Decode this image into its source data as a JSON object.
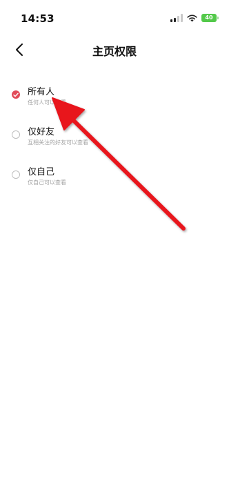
{
  "status_bar": {
    "time": "14:53",
    "battery": "40"
  },
  "header": {
    "title": "主页权限"
  },
  "options": [
    {
      "label": "所有人",
      "description": "任何人可以查看",
      "selected": true
    },
    {
      "label": "仅好友",
      "description": "互相关注的好友可以查看",
      "selected": false
    },
    {
      "label": "仅自己",
      "description": "仅自己可以查看",
      "selected": false
    }
  ],
  "colors": {
    "accent": "#e24b59",
    "arrow": "#e8121f"
  }
}
